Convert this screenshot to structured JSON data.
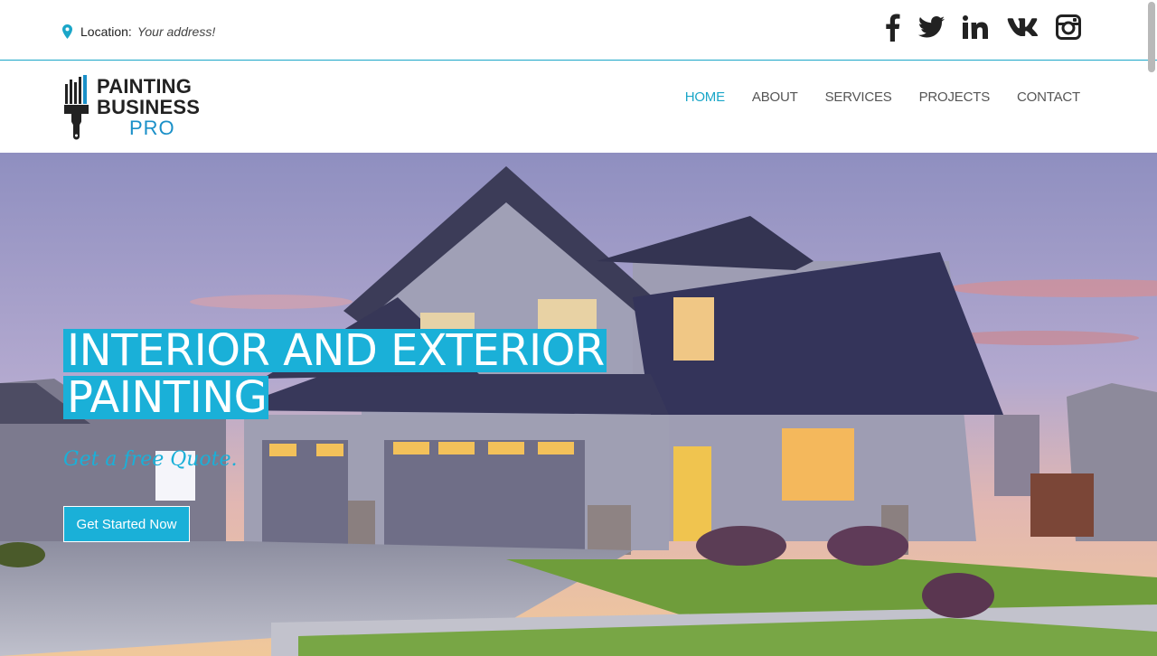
{
  "topbar": {
    "location_label": "Location:",
    "location_value": "Your address!",
    "social": [
      "facebook-icon",
      "twitter-icon",
      "linkedin-icon",
      "vk-icon",
      "instagram-icon"
    ]
  },
  "logo": {
    "line1": "PAINTING",
    "line2": "BUSINESS",
    "line3": "PRO"
  },
  "nav": {
    "items": [
      {
        "label": "HOME",
        "active": true
      },
      {
        "label": "ABOUT",
        "active": false
      },
      {
        "label": "SERVICES",
        "active": false
      },
      {
        "label": "PROJECTS",
        "active": false
      },
      {
        "label": "CONTACT",
        "active": false
      }
    ]
  },
  "hero": {
    "title_line1": "INTERIOR AND EXTERIOR",
    "title_line2": "PAINTING",
    "subtitle": "Get a free Quote.",
    "cta_label": "Get Started Now"
  },
  "colors": {
    "accent": "#1ab0d8",
    "brand_blue": "#1a90c8",
    "nav_text": "#555555"
  }
}
